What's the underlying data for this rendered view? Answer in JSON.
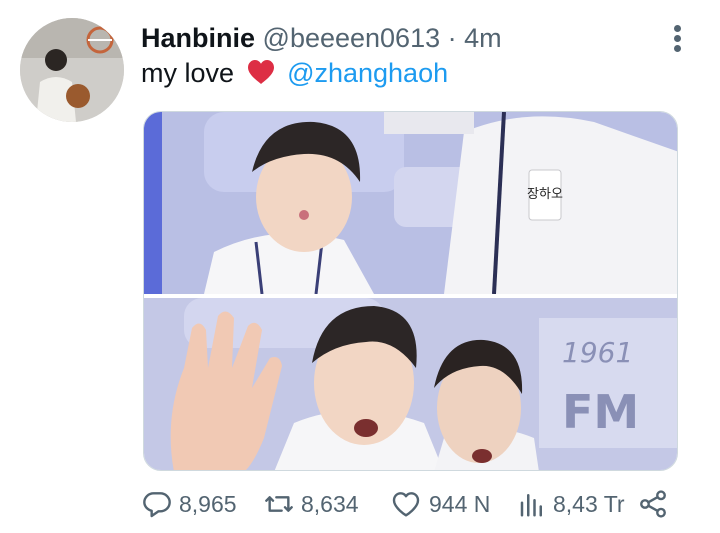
{
  "tweet": {
    "display_name": "Hanbinie",
    "handle": "@beeeen0613",
    "separator": "·",
    "time": "4m",
    "text_before": "my love",
    "mention": "@zhanghaoh"
  },
  "photo_text": {
    "name_tag": "장하오",
    "sign_number": "1961",
    "sign_letters": "FM"
  },
  "actions": {
    "replies": "8,965",
    "retweets": "8,634",
    "likes": "944 N",
    "views": "8,43 Tr"
  },
  "colors": {
    "text": "#0f1419",
    "secondary": "#536471",
    "link": "#1d9bf0",
    "heart": "#e0245e"
  },
  "icons": [
    "avatar",
    "more-vertical-icon",
    "red-heart-emoji",
    "reply-icon",
    "retweet-icon",
    "like-icon",
    "views-icon",
    "share-icon"
  ]
}
